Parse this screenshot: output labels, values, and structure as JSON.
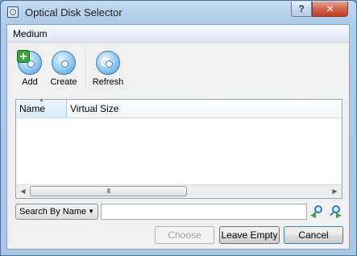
{
  "window": {
    "title": "Optical Disk Selector",
    "help_label": "?",
    "close_label": "✕"
  },
  "menubar": {
    "medium_label": "Medium"
  },
  "toolbar": {
    "add_label": "Add",
    "create_label": "Create",
    "refresh_label": "Refresh"
  },
  "list": {
    "columns": [
      "Name",
      "Virtual Size"
    ],
    "sorted_column": "Name",
    "rows": []
  },
  "scrollbar": {
    "thumb_grip": "III"
  },
  "search": {
    "mode_selected": "Search By Name",
    "value": ""
  },
  "buttons": {
    "choose_label": "Choose",
    "leave_empty_label": "Leave Empty",
    "cancel_label": "Cancel",
    "choose_enabled": false
  }
}
